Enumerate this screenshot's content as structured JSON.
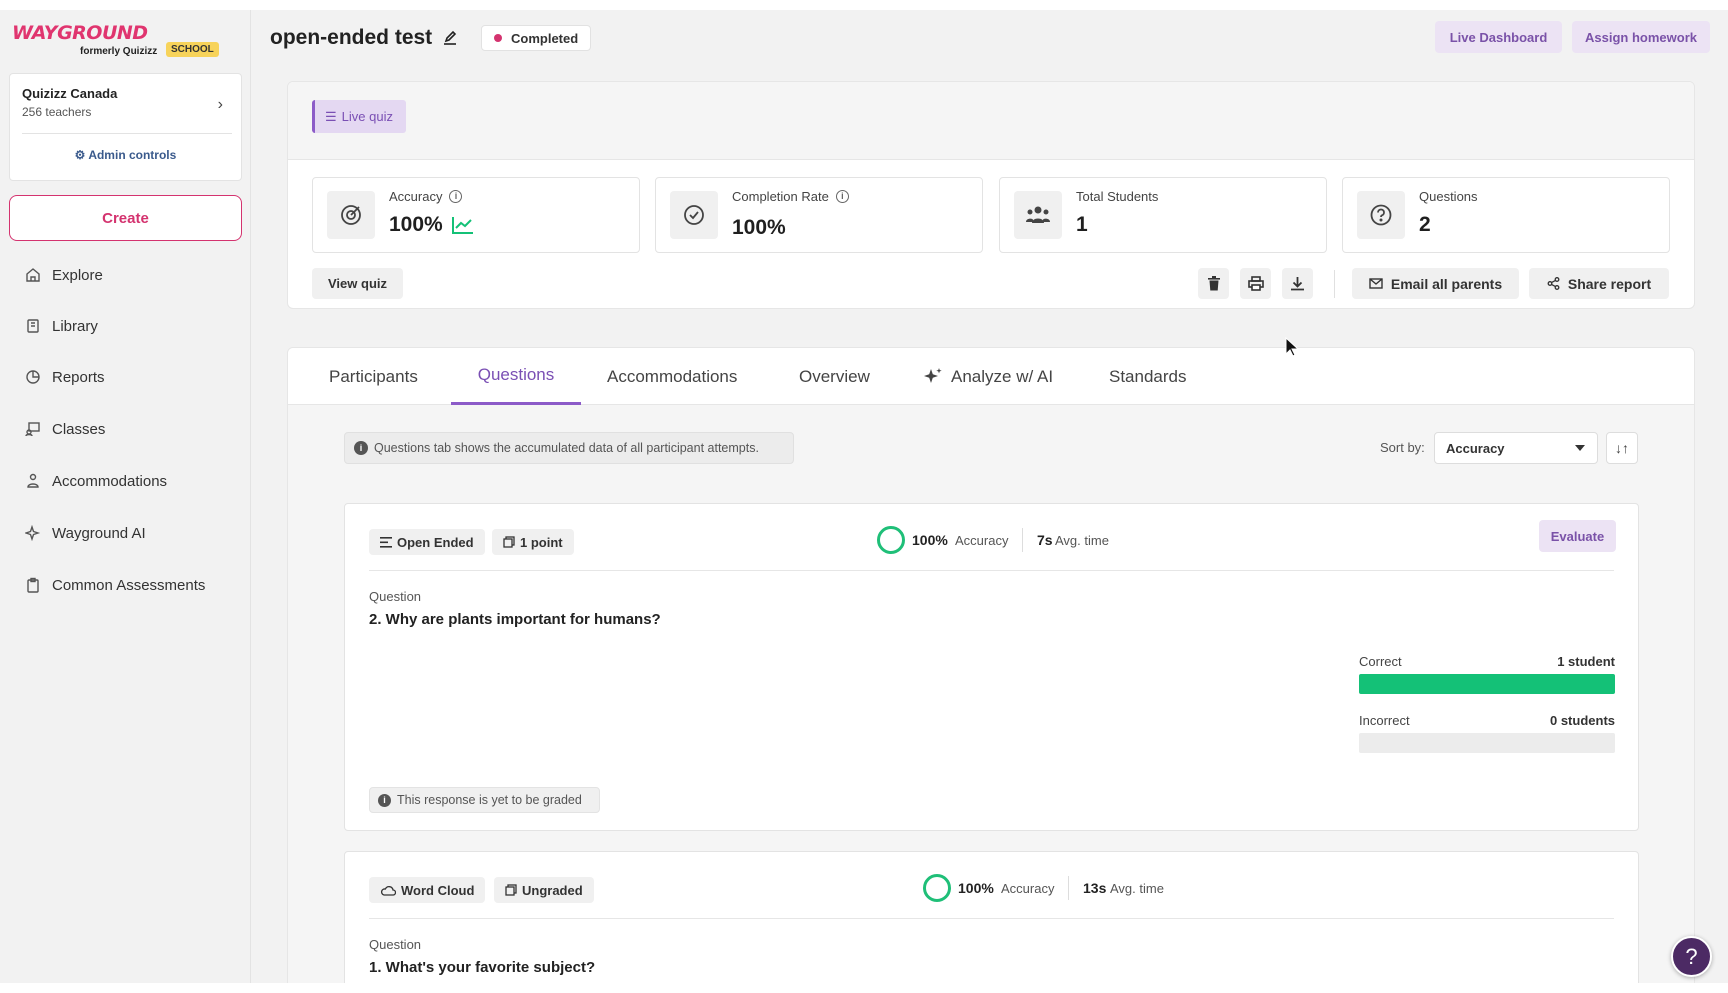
{
  "brand": {
    "logo_text": "WAYGROUND",
    "formerly": "formerly Quizizz",
    "badge": "SCHOOL"
  },
  "org": {
    "name": "Quizizz Canada",
    "teachers": "256 teachers",
    "admin_label": "Admin controls"
  },
  "sidebar": {
    "create_label": "Create",
    "items": [
      {
        "label": "Explore",
        "icon": "home-icon"
      },
      {
        "label": "Library",
        "icon": "library-icon"
      },
      {
        "label": "Reports",
        "icon": "reports-icon"
      },
      {
        "label": "Classes",
        "icon": "classes-icon"
      },
      {
        "label": "Accommodations",
        "icon": "accommodations-icon"
      },
      {
        "label": "Wayground AI",
        "icon": "sparkle-icon"
      },
      {
        "label": "Common Assessments",
        "icon": "clipboard-icon"
      }
    ]
  },
  "header": {
    "title": "open-ended test",
    "status": "Completed",
    "live_dashboard": "Live Dashboard",
    "assign_homework": "Assign homework"
  },
  "summary": {
    "mode": "Live quiz",
    "stats": [
      {
        "label": "Accuracy",
        "value": "100%",
        "icon": "target-icon"
      },
      {
        "label": "Completion Rate",
        "value": "100%",
        "icon": "check-circle-icon"
      },
      {
        "label": "Total Students",
        "value": "1",
        "icon": "users-icon"
      },
      {
        "label": "Questions",
        "value": "2",
        "icon": "question-circle-icon"
      }
    ],
    "view_quiz": "View quiz",
    "email_parents": "Email all parents",
    "share_report": "Share report"
  },
  "tabs": [
    {
      "label": "Participants",
      "active": false
    },
    {
      "label": "Questions",
      "active": true
    },
    {
      "label": "Accommodations",
      "active": false
    },
    {
      "label": "Overview",
      "active": false
    },
    {
      "label": "Analyze w/ AI",
      "active": false
    },
    {
      "label": "Standards",
      "active": false
    }
  ],
  "questions_tab": {
    "notice": "Questions tab shows the accumulated data of all participant attempts.",
    "sort_label": "Sort by:",
    "sort_value": "Accuracy"
  },
  "questions": [
    {
      "type": "Open Ended",
      "points": "1 point",
      "accuracy": "100%",
      "accuracy_label": "Accuracy",
      "time": "7s",
      "time_label": "Avg. time",
      "evaluate": "Evaluate",
      "question_label": "Question",
      "text": "2. Why are plants important for humans?",
      "correct_label": "Correct",
      "correct_count": "1 student",
      "correct_fraction": 1.0,
      "incorrect_label": "Incorrect",
      "incorrect_count": "0 students",
      "incorrect_fraction": 0.0,
      "graded_note": "This response is yet to be graded"
    },
    {
      "type": "Word Cloud",
      "points": "Ungraded",
      "accuracy": "100%",
      "accuracy_label": "Accuracy",
      "time": "13s",
      "time_label": "Avg. time",
      "question_label": "Question",
      "text": "1. What's your favorite subject?"
    }
  ],
  "colors": {
    "brand": "#e0356f",
    "accent": "#8c5bc8",
    "success": "#14c177",
    "help": "#4c2a64"
  }
}
